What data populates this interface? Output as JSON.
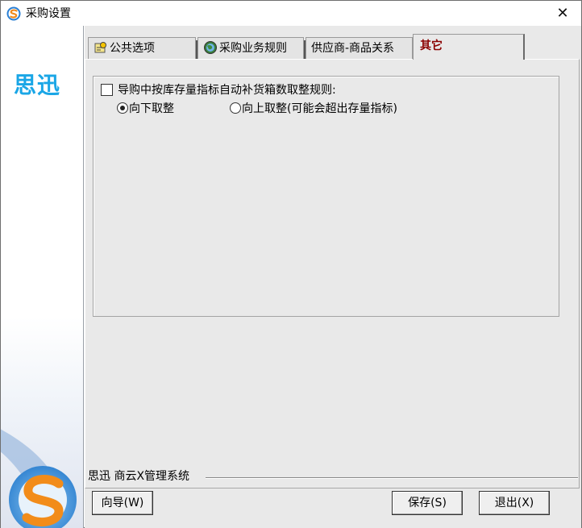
{
  "window": {
    "title": "采购设置",
    "close_glyph": "✕"
  },
  "sidebar": {
    "brand": "思迅"
  },
  "tabs": [
    {
      "label": "公共选项",
      "icon": "key-icon"
    },
    {
      "label": "采购业务规则",
      "icon": "globe-icon"
    },
    {
      "label": "供应商-商品关系",
      "icon": ""
    },
    {
      "label": "其它",
      "icon": ""
    }
  ],
  "active_tab": "其它",
  "settings": {
    "checkbox_label": "导购中按库存量指标自动补货箱数取整规则:",
    "checkbox_checked": false,
    "radio_down_label": "向下取整",
    "radio_up_label": "向上取整(可能会超出存量指标)",
    "selected_radio": "向下取整"
  },
  "footer": {
    "product_label": "思迅 商云X管理系统",
    "wizard_button": "向导(W)",
    "save_button": "保存(S)",
    "exit_button": "退出(X)"
  },
  "colors": {
    "active_tab_text": "#8b0000",
    "brand_blue": "#1aa6e6",
    "panel_bg": "#e9e9e9"
  }
}
